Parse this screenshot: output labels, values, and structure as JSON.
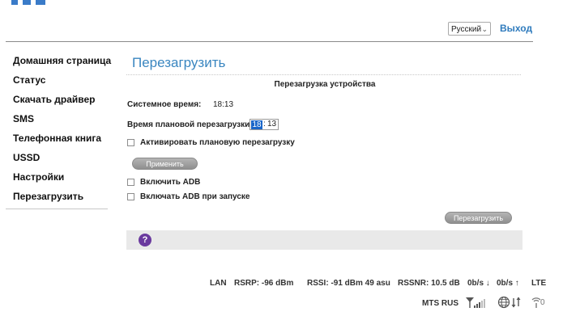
{
  "header": {
    "language": "Русский",
    "logout": "Выход"
  },
  "sidebar": {
    "items": [
      {
        "label": "Домашняя страница"
      },
      {
        "label": "Статус"
      },
      {
        "label": "Скачать драйвер"
      },
      {
        "label": "SMS"
      },
      {
        "label": "Телефонная книга"
      },
      {
        "label": "USSD"
      },
      {
        "label": "Настройки"
      },
      {
        "label": "Перезагрузить"
      }
    ]
  },
  "main": {
    "title": "Перезагрузить",
    "section_title": "Перезагрузка устройства",
    "system_time_label": "Системное время:",
    "system_time_value": "18:13",
    "scheduled_label": "Время плановой перезагрузки",
    "scheduled_hour": "18",
    "scheduled_sep": ":",
    "scheduled_minute": "13",
    "activate_label": "Активировать плановую перезагрузку",
    "apply_button": "Применить",
    "adb_label": "Включить ADB",
    "adb_startup_label": "Включать ADB при запуске",
    "reboot_button": "Перезагрузить",
    "help_icon": "?"
  },
  "status_bar": {
    "lan": "LAN",
    "rsrp": "RSRP: -96 dBm",
    "rssi": "RSSI: -91 dBm 49 asu",
    "rssnr": "RSSNR: 10.5 dB",
    "down": "0b/s ↓",
    "up": "0b/s ↑",
    "network_type": "LTE",
    "operator": "MTS RUS",
    "wifi_clients": "0"
  },
  "colors": {
    "accent": "#2f7bbd",
    "title": "#3a86c0",
    "help": "#6a3a9e",
    "highlight": "#1a66c9"
  },
  "icons": [
    "signal-icon",
    "globe-icon",
    "transfer-icon",
    "wifi-icon"
  ]
}
